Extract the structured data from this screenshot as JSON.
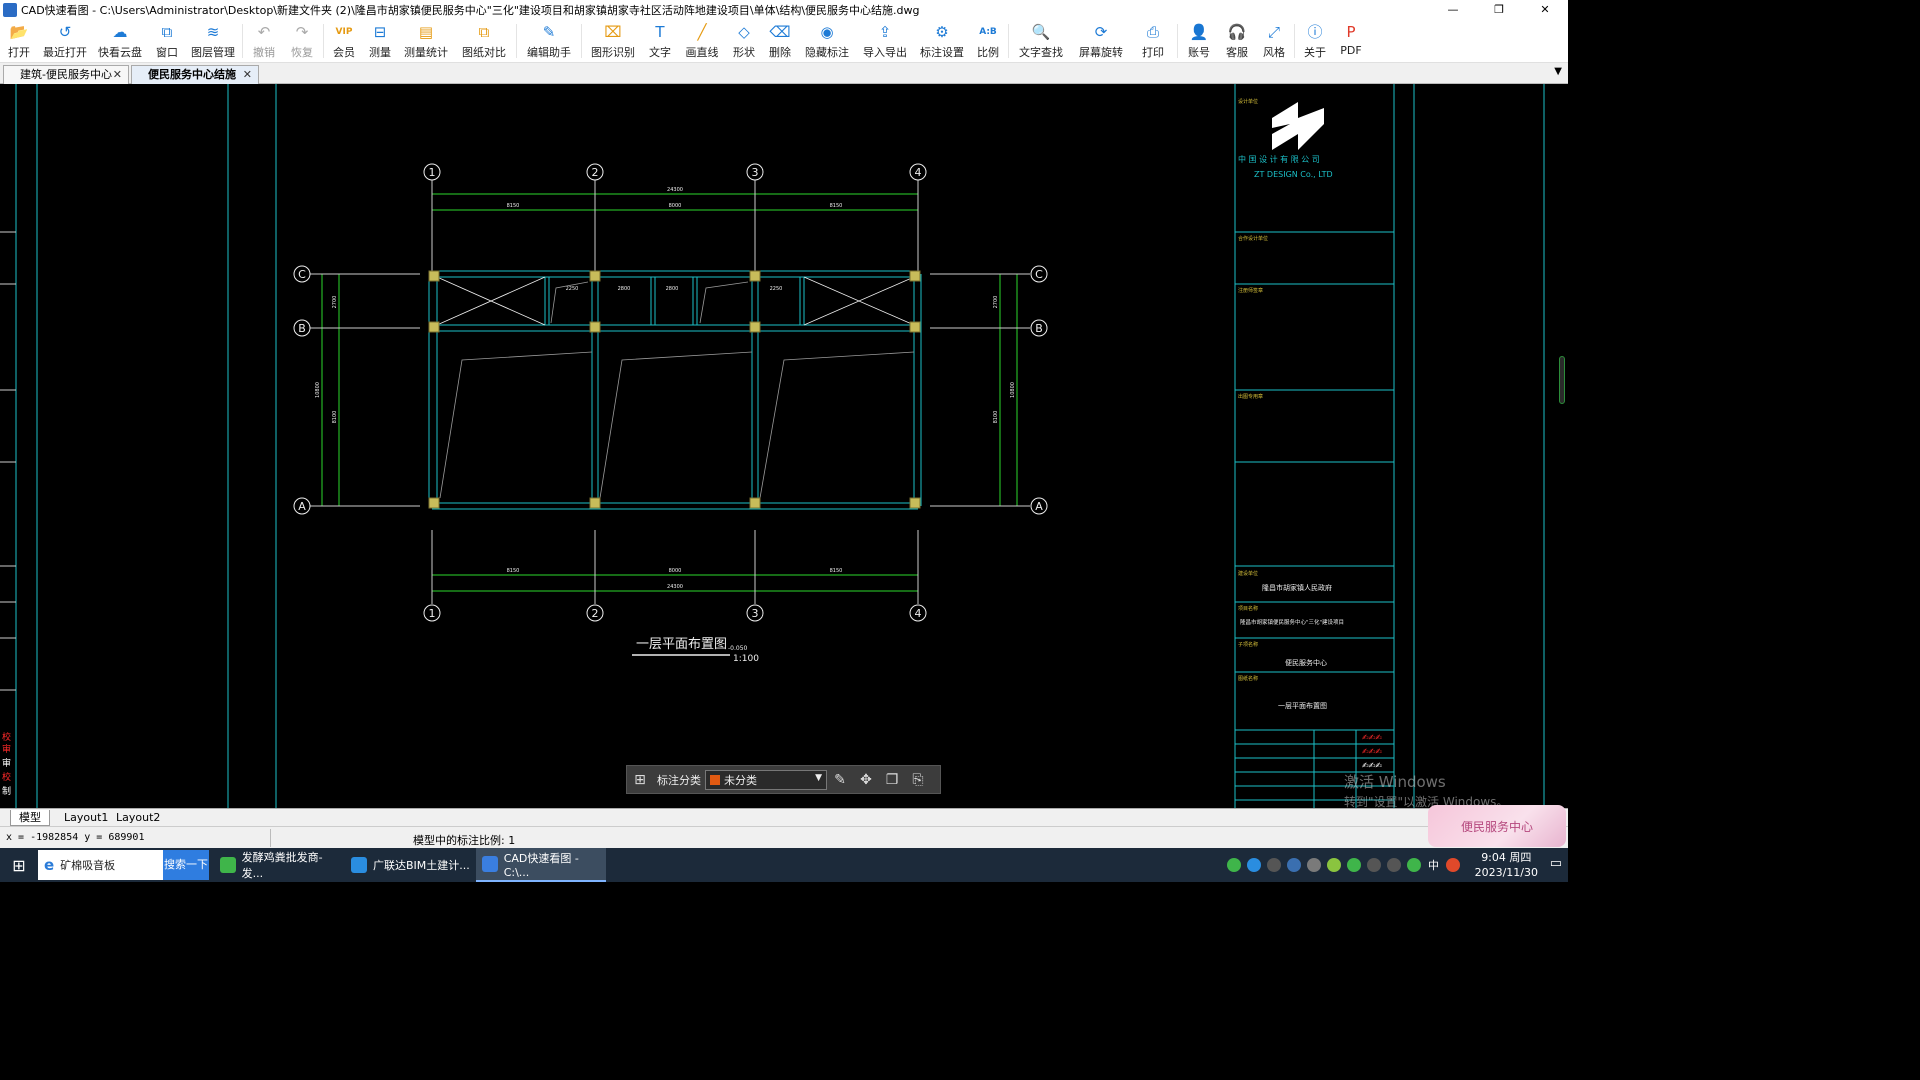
{
  "window": {
    "title": "CAD快速看图 - C:\\Users\\Administrator\\Desktop\\新建文件夹 (2)\\隆昌市胡家镇便民服务中心\"三化\"建设项目和胡家镇胡家寺社区活动阵地建设项目\\单体\\结构\\便民服务中心结施.dwg",
    "controls": [
      "—",
      "❐",
      "✕"
    ]
  },
  "toolbar": [
    {
      "name": "open",
      "label": "打开",
      "icon": "folder-open-icon",
      "color": "#1e7bd6",
      "glyph": "📂"
    },
    {
      "name": "recent",
      "label": "最近打开",
      "icon": "clock-history-icon",
      "color": "#1e7bd6",
      "glyph": "↺"
    },
    {
      "name": "cloud",
      "label": "快看云盘",
      "icon": "cloud-icon",
      "color": "#1e7bd6",
      "glyph": "☁"
    },
    {
      "name": "window",
      "label": "窗口",
      "icon": "window-icon",
      "color": "#1e7bd6",
      "glyph": "⧉"
    },
    {
      "name": "layers",
      "label": "图层管理",
      "icon": "layers-icon",
      "color": "#1e7bd6",
      "glyph": "≋"
    },
    {
      "name": "undo",
      "label": "撤销",
      "icon": "undo-icon",
      "color": "#aaa",
      "glyph": "↶",
      "disabled": true
    },
    {
      "name": "redo",
      "label": "恢复",
      "icon": "redo-icon",
      "color": "#aaa",
      "glyph": "↷",
      "disabled": true
    },
    {
      "name": "vip",
      "label": "会员",
      "icon": "vip-crown-icon",
      "color": "#e59a12",
      "glyph": "VIP"
    },
    {
      "name": "measure",
      "label": "测量",
      "icon": "ruler-icon",
      "color": "#1e7bd6",
      "glyph": "⊟"
    },
    {
      "name": "measure-stats",
      "label": "测量统计",
      "icon": "measure-stats-icon",
      "color": "#e59a12",
      "glyph": "▤"
    },
    {
      "name": "compare",
      "label": "图纸对比",
      "icon": "compare-icon",
      "color": "#e59a12",
      "glyph": "⧉"
    },
    {
      "name": "edit-assist",
      "label": "编辑助手",
      "icon": "edit-assistant-icon",
      "color": "#1e7bd6",
      "glyph": "✎"
    },
    {
      "name": "shape-recog",
      "label": "图形识别",
      "icon": "shape-recognition-icon",
      "color": "#e59a12",
      "glyph": "⌧"
    },
    {
      "name": "text",
      "label": "文字",
      "icon": "text-icon",
      "color": "#1e7bd6",
      "glyph": "T"
    },
    {
      "name": "line",
      "label": "画直线",
      "icon": "line-icon",
      "color": "#e59a12",
      "glyph": "╱"
    },
    {
      "name": "shape",
      "label": "形状",
      "icon": "shape-icon",
      "color": "#1e7bd6",
      "glyph": "◇"
    },
    {
      "name": "delete",
      "label": "删除",
      "icon": "eraser-icon",
      "color": "#1e7bd6",
      "glyph": "⌫"
    },
    {
      "name": "hide-annot",
      "label": "隐藏标注",
      "icon": "eye-hide-icon",
      "color": "#1e7bd6",
      "glyph": "◉"
    },
    {
      "name": "import-export",
      "label": "导入导出",
      "icon": "import-export-icon",
      "color": "#1e7bd6",
      "glyph": "⇪"
    },
    {
      "name": "annot-settings",
      "label": "标注设置",
      "icon": "settings-icon",
      "color": "#1e7bd6",
      "glyph": "⚙"
    },
    {
      "name": "scale",
      "label": "比例",
      "icon": "scale-icon",
      "color": "#1e7bd6",
      "glyph": "A:B"
    },
    {
      "name": "text-search",
      "label": "文字查找",
      "icon": "text-search-icon",
      "color": "#1e7bd6",
      "glyph": "🔍"
    },
    {
      "name": "rotate",
      "label": "屏幕旋转",
      "icon": "rotate-screen-icon",
      "color": "#1e7bd6",
      "glyph": "⟳"
    },
    {
      "name": "print",
      "label": "打印",
      "icon": "printer-icon",
      "color": "#1e7bd6",
      "glyph": "⎙"
    },
    {
      "name": "account",
      "label": "账号",
      "icon": "user-icon",
      "color": "#1e7bd6",
      "glyph": "👤"
    },
    {
      "name": "service",
      "label": "客服",
      "icon": "headset-icon",
      "color": "#1e7bd6",
      "glyph": "🎧"
    },
    {
      "name": "style",
      "label": "风格",
      "icon": "style-icon",
      "color": "#1e7bd6",
      "glyph": "⤢"
    },
    {
      "name": "about",
      "label": "关于",
      "icon": "info-icon",
      "color": "#1e7bd6",
      "glyph": "ⓘ"
    },
    {
      "name": "pdf",
      "label": "PDF",
      "icon": "pdf-icon",
      "color": "#e03a2a",
      "glyph": "P"
    }
  ],
  "doc_tabs": [
    {
      "label": "建筑-便民服务中心",
      "close": "✕",
      "active": false
    },
    {
      "label": "便民服务中心结施",
      "close": "✕",
      "active": true
    }
  ],
  "tabs_menu": "▼",
  "drawing": {
    "axes_numbers": [
      "1",
      "2",
      "3",
      "4"
    ],
    "axes_letters": [
      "A",
      "B",
      "C"
    ],
    "dim_total": "24300",
    "dim_spans": [
      "8150",
      "8000",
      "8150"
    ],
    "dim_vertical": [
      "2700",
      "8100",
      "10800"
    ],
    "room_dims": [
      "2250",
      "2800",
      "2800",
      "2250"
    ],
    "plan_title": "一层平面布置图",
    "plan_elev": "-0.050",
    "plan_scale": "1:100",
    "title_block": {
      "company_cn": "中 国 设 计 有 限 公 司",
      "company_en": "ZT DESIGN Co., LTD",
      "section_labels": [
        "设计单位",
        "合作设计单位",
        "注册师签章",
        "出图专用章",
        "建设单位",
        "项目名称",
        "子项名称",
        "图纸名称"
      ],
      "client": "隆昌市胡家镇人民政府",
      "project": "隆昌市胡家镇便民服务中心\"三化\"建设项目",
      "subitem": "便民服务中心",
      "drawing_name": "一层平面布置图"
    }
  },
  "popup": {
    "label": "标注分类",
    "select_value": "未分类",
    "swatch_color": "#e25a12"
  },
  "layout_tabs": [
    "模型",
    "Layout1",
    "Layout2"
  ],
  "status": {
    "coords": "x = -1982854  y = 689901",
    "scale_text": "模型中的标注比例: 1"
  },
  "taskbar": {
    "search_text": "矿棉吸音板",
    "search_button": "搜索一下",
    "tasks": [
      {
        "label": "发酵鸡粪批发商-发...",
        "color": "#3fb54a"
      },
      {
        "label": "广联达BIM土建计...",
        "color": "#2a8de0"
      },
      {
        "label": "CAD快速看图 - C:\\...",
        "color": "#3a7ee0"
      }
    ],
    "tray_ime": "中",
    "time": "9:04 周四",
    "date": "2023/11/30"
  },
  "watermark": {
    "line1": "激活 Windows",
    "line2": "转到\"设置\"以激活 Windows。"
  },
  "sticker": "便民服务中心"
}
